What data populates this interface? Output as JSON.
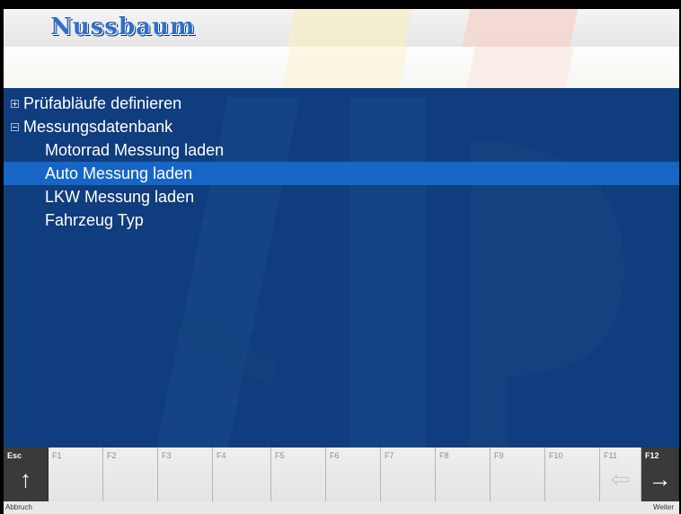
{
  "header": {
    "logo": "Nussbaum"
  },
  "tree": {
    "items": [
      {
        "label": "Prüfabläufe definieren",
        "level": 0,
        "expander": "plus",
        "selected": false
      },
      {
        "label": "Messungsdatenbank",
        "level": 0,
        "expander": "minus",
        "selected": false
      },
      {
        "label": "Motorrad Messung laden",
        "level": 1,
        "expander": "none",
        "selected": false
      },
      {
        "label": "Auto Messung laden",
        "level": 1,
        "expander": "none",
        "selected": true
      },
      {
        "label": "LKW Messung laden",
        "level": 1,
        "expander": "none",
        "selected": false
      },
      {
        "label": "Fahrzeug Typ",
        "level": 1,
        "expander": "none",
        "selected": false
      }
    ]
  },
  "function_keys": {
    "keys": [
      {
        "name": "Esc",
        "icon": "arrow-up-icon",
        "active": true
      },
      {
        "name": "F1",
        "icon": "",
        "active": false
      },
      {
        "name": "F2",
        "icon": "",
        "active": false
      },
      {
        "name": "F3",
        "icon": "",
        "active": false
      },
      {
        "name": "F4",
        "icon": "",
        "active": false
      },
      {
        "name": "F5",
        "icon": "",
        "active": false
      },
      {
        "name": "F6",
        "icon": "",
        "active": false
      },
      {
        "name": "F7",
        "icon": "",
        "active": false
      },
      {
        "name": "F8",
        "icon": "",
        "active": false
      },
      {
        "name": "F9",
        "icon": "",
        "active": false
      },
      {
        "name": "F10",
        "icon": "",
        "active": false
      },
      {
        "name": "F11",
        "icon": "arrow-left-outline-icon",
        "active": false
      },
      {
        "name": "F12",
        "icon": "arrow-right-icon",
        "active": true
      }
    ],
    "esc_caption": "Abbruch",
    "f12_caption": "Weiter"
  },
  "colors": {
    "panel_blue": "#0f3d7e",
    "selection_blue": "#1766c6",
    "logo_blue": "#2f6fc8"
  }
}
